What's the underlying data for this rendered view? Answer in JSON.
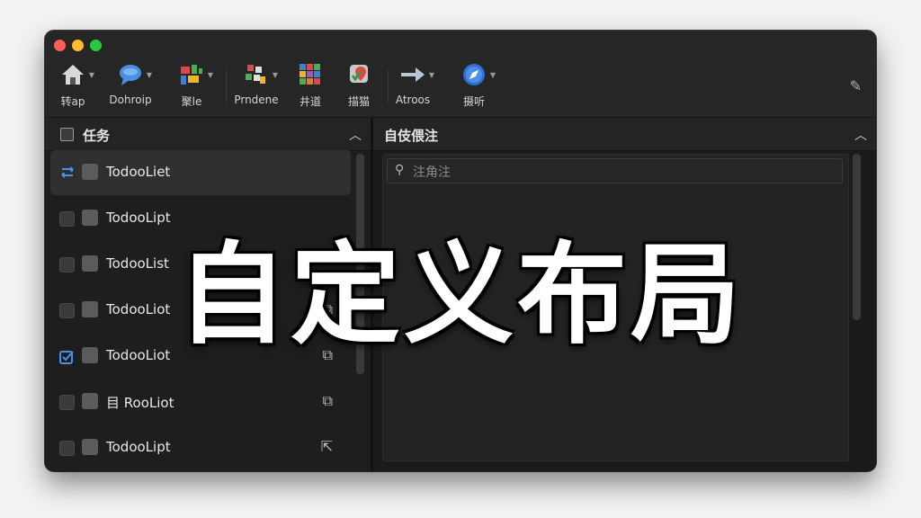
{
  "toolbar": {
    "tools": [
      {
        "label": "转ap",
        "icon": "home-icon"
      },
      {
        "label": "Dohroip",
        "icon": "chat-bubble-icon"
      },
      {
        "label": "聚le",
        "icon": "grid-tiles-icon"
      },
      {
        "label": "Prndene",
        "icon": "puzzle-grid-icon"
      },
      {
        "label": "井道",
        "icon": "color-grid-icon"
      },
      {
        "label": "描猫",
        "icon": "map-pin-icon"
      },
      {
        "label": "Atroos",
        "icon": "arrow-right-icon"
      },
      {
        "label": "摄听",
        "icon": "compass-icon"
      }
    ]
  },
  "tasks": {
    "title": "任务",
    "items": [
      {
        "label": "TodooLiet"
      },
      {
        "label": "TodooLipt"
      },
      {
        "label": "TodooList"
      },
      {
        "label": "TodooLiot"
      },
      {
        "label": "TodooLiot"
      },
      {
        "label": "目 RooLiot"
      },
      {
        "label": "TodooLipt"
      }
    ]
  },
  "notes": {
    "title": "自伎偎注",
    "input_placeholder": "注角注"
  },
  "overlay": {
    "text": "自定义布局"
  }
}
